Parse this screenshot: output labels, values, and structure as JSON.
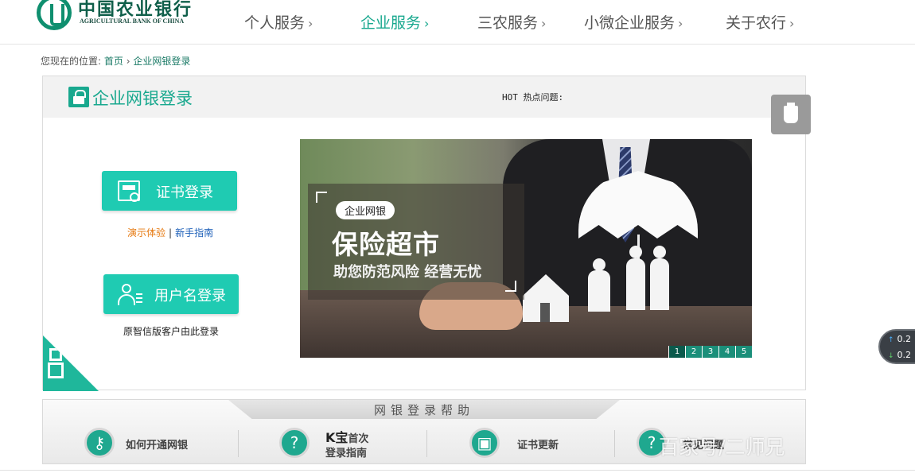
{
  "header": {
    "logo_cn": "中国农业银行",
    "logo_en": "AGRICULTURAL BANK OF CHINA",
    "nav": [
      {
        "label": "个人服务",
        "arrow": "›"
      },
      {
        "label": "企业服务",
        "arrow": "›",
        "active": true
      },
      {
        "label": "三农服务",
        "arrow": "›"
      },
      {
        "label": "小微企业服务",
        "arrow": "›"
      },
      {
        "label": "关于农行",
        "arrow": "›"
      }
    ]
  },
  "breadcrumb": {
    "prefix": "您现在的位置:",
    "home": "首页",
    "sep": "›",
    "current": "企业网银登录"
  },
  "panel": {
    "title": "企业网银登录",
    "hot": "HOT 热点问题:",
    "cert_login": "证书登录",
    "demo": "演示体验",
    "demo_sep": "|",
    "guide": "新手指南",
    "user_login": "用户名登录",
    "zx_note": "原智信版客户由此登录"
  },
  "banner": {
    "tag": "企业网银",
    "title": "保险超市",
    "subtitle": "助您防范风险  经营无忧",
    "pages": [
      "1",
      "2",
      "3",
      "4",
      "5"
    ],
    "active_page": 1
  },
  "speed": {
    "up": "0.2",
    "down": "0.2",
    "up_arrow": "↑",
    "down_arrow": "↓"
  },
  "help": {
    "title": "网银登录帮助",
    "items": [
      {
        "label": "如何开通网银",
        "icon": "key-icon",
        "glyph": "⚷"
      },
      {
        "label_k": "K宝",
        "label_a": "首次",
        "label_b": "登录指南",
        "icon": "k-bao-icon",
        "glyph": "?"
      },
      {
        "label": "证书更新",
        "icon": "certificate-icon",
        "glyph": "▣"
      },
      {
        "label": "常见问题",
        "icon": "question-icon",
        "glyph": "?"
      }
    ]
  },
  "watermark": "百家号/二师兄",
  "colors": {
    "brand_green": "#0f8f6f",
    "accent_teal": "#18a88e",
    "button_teal": "#1fcbb2",
    "demo_orange": "#e67a12",
    "guide_blue": "#1c5fb8"
  }
}
